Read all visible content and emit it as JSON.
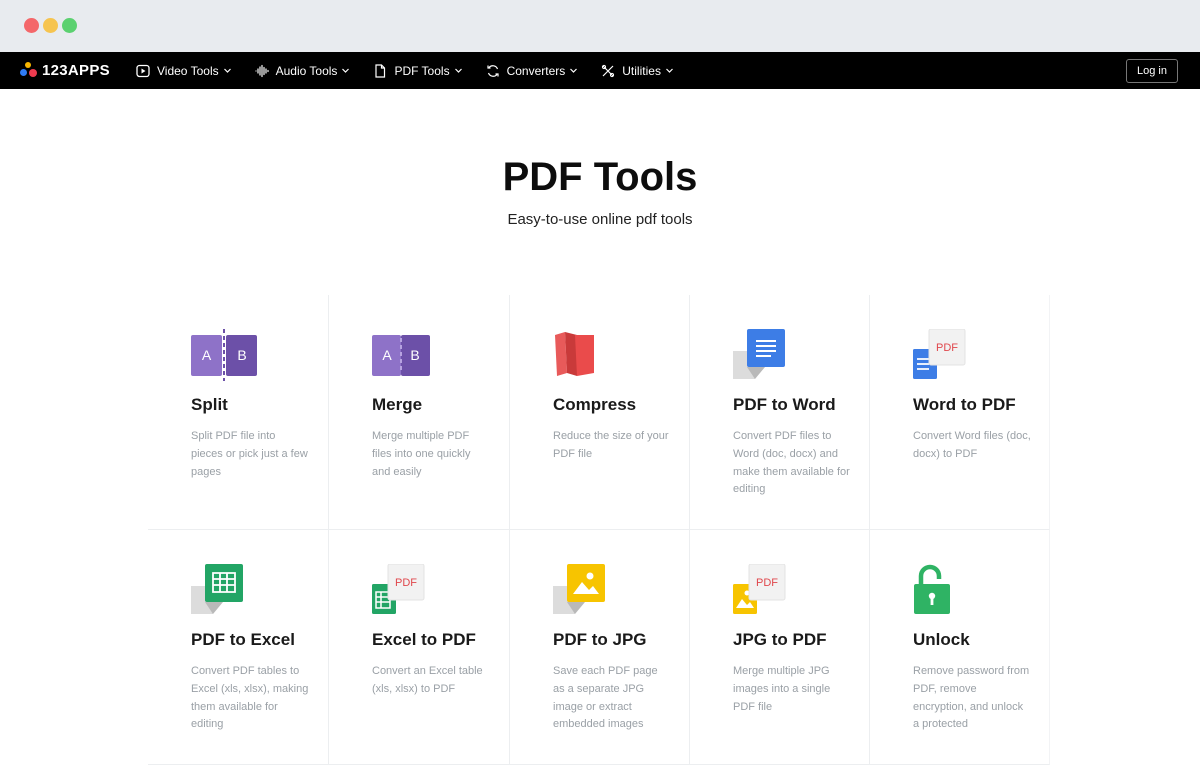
{
  "brand": {
    "name": "123APPS"
  },
  "nav": {
    "items": [
      {
        "label": "Video Tools",
        "icon": "video-icon"
      },
      {
        "label": "Audio Tools",
        "icon": "audio-wave-icon"
      },
      {
        "label": "PDF Tools",
        "icon": "document-icon"
      },
      {
        "label": "Converters",
        "icon": "convert-icon"
      },
      {
        "label": "Utilities",
        "icon": "tools-icon"
      }
    ],
    "login_label": "Log in"
  },
  "hero": {
    "title": "PDF Tools",
    "subtitle": "Easy-to-use online pdf tools"
  },
  "tools": [
    {
      "title": "Split",
      "desc": "Split PDF file into pieces or pick just a few pages",
      "icon": "split-icon"
    },
    {
      "title": "Merge",
      "desc": "Merge multiple PDF files into one quickly and easily",
      "icon": "merge-icon"
    },
    {
      "title": "Compress",
      "desc": "Reduce the size of your PDF file",
      "icon": "compress-icon"
    },
    {
      "title": "PDF to Word",
      "desc": "Convert PDF files to Word (doc, docx) and make them available for editing",
      "icon": "pdf-to-word-icon"
    },
    {
      "title": "Word to PDF",
      "desc": "Convert Word files (doc, docx) to PDF",
      "icon": "word-to-pdf-icon"
    },
    {
      "title": "PDF to Excel",
      "desc": "Convert PDF tables to Excel (xls, xlsx), making them available for editing",
      "icon": "pdf-to-excel-icon"
    },
    {
      "title": "Excel to PDF",
      "desc": "Convert an Excel table (xls, xlsx) to PDF",
      "icon": "excel-to-pdf-icon"
    },
    {
      "title": "PDF to JPG",
      "desc": "Save each PDF page as a separate JPG image or extract embedded images",
      "icon": "pdf-to-jpg-icon"
    },
    {
      "title": "JPG to PDF",
      "desc": "Merge multiple JPG images into a single PDF file",
      "icon": "jpg-to-pdf-icon"
    },
    {
      "title": "Unlock",
      "desc": "Remove password from PDF, remove encryption, and unlock a protected",
      "icon": "unlock-icon"
    }
  ],
  "icon_text": {
    "a": "A",
    "b": "B",
    "pdf": "PDF"
  },
  "colors": {
    "purple_light": "#8e72c8",
    "purple_dark": "#6c50a8",
    "red": "#ea4b4b",
    "blue": "#3d7de6",
    "green": "#22a565",
    "yellow": "#f7c400",
    "unlock_green": "#2fb364"
  }
}
